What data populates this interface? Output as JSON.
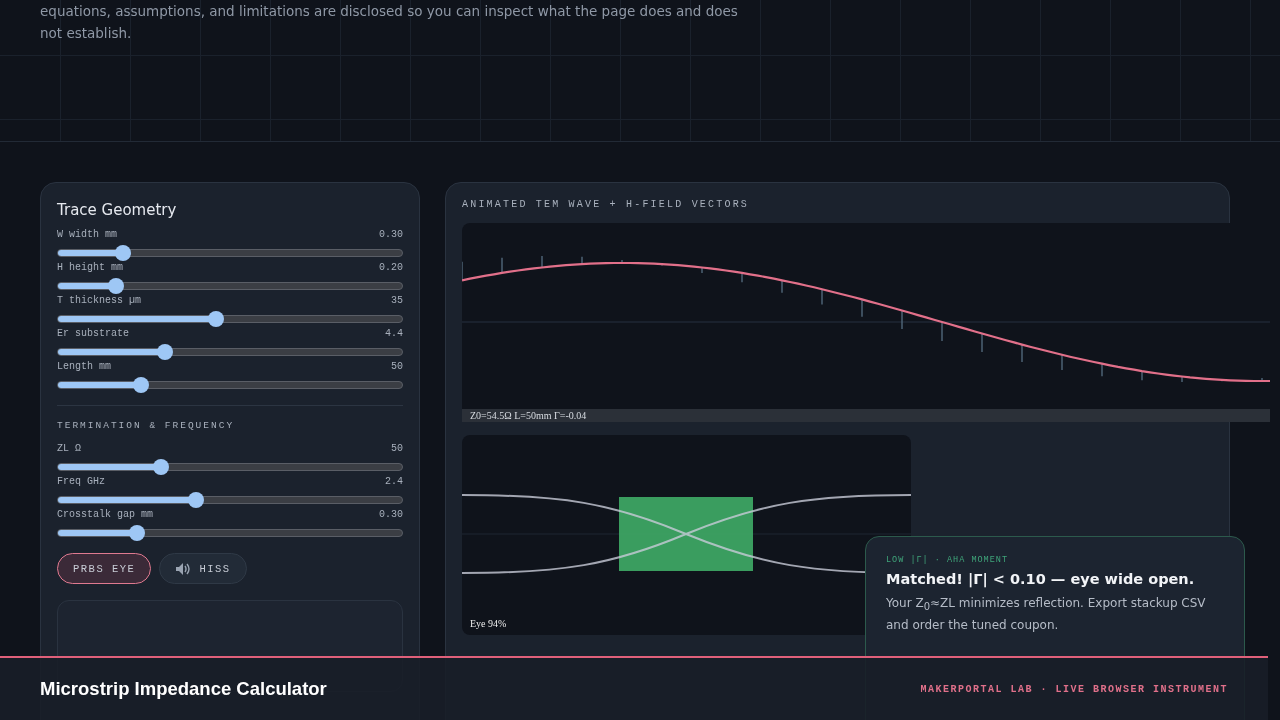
{
  "intro": {
    "lines": [
      "equations, assumptions, and limitations are disclosed so you can inspect what the page does and does",
      "not establish."
    ]
  },
  "geometry": {
    "title": "Trace Geometry",
    "sliders": [
      {
        "label": "W width mm",
        "value": "0.30",
        "level": 0.19
      },
      {
        "label": "H height mm",
        "value": "0.20",
        "level": 0.17
      },
      {
        "label": "T thickness µm",
        "value": "35",
        "level": 0.46
      },
      {
        "label": "Er substrate",
        "value": "4.4",
        "level": 0.31
      },
      {
        "label": "Length mm",
        "value": "50",
        "level": 0.24
      }
    ]
  },
  "termination": {
    "title": "TERMINATION & FREQUENCY",
    "sliders": [
      {
        "label": "ZL Ω",
        "value": "50",
        "level": 0.3
      },
      {
        "label": "Freq GHz",
        "value": "2.4",
        "level": 0.4
      },
      {
        "label": "Crosstalk gap mm",
        "value": "0.30",
        "level": 0.23
      }
    ]
  },
  "toggles": [
    {
      "label": "PRBS EYE",
      "icon": false,
      "on": true
    },
    {
      "label": "HISS",
      "icon": true,
      "on": false
    }
  ],
  "wave": {
    "title": "ANIMATED TEM WAVE + H-FIELD VECTORS",
    "readout": "Z0=54.5Ω  L=50mm  Γ=-0.04"
  },
  "eye": {
    "label": "Eye 94%"
  },
  "toast": {
    "tag": "LOW |Γ| · AHA MOMENT",
    "title": "Matched! |Γ| < 0.10 — eye wide open.",
    "body": "Your Z$_{0}$≈ZL minimizes reflection. Export stackup CSV and order the tuned coupon."
  },
  "footer": {
    "title": "Microstrip Impedance Calculator",
    "credit": "MAKERPORTAL LAB · LIVE BROWSER INSTRUMENT"
  }
}
